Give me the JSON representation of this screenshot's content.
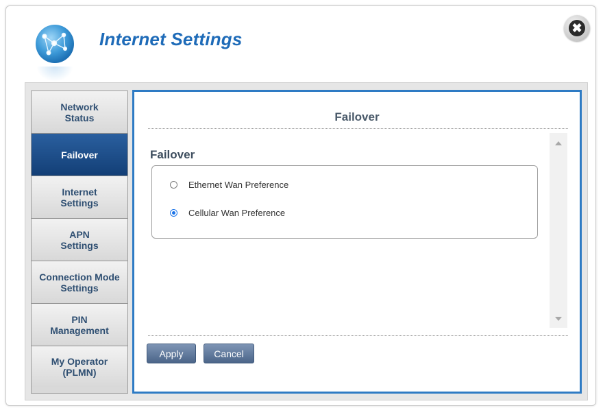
{
  "window": {
    "title": "Internet Settings",
    "close_symbol": "✖",
    "logo_icon": "globe-network-icon"
  },
  "sidebar": {
    "items": [
      {
        "label": "Network\nStatus",
        "active": false
      },
      {
        "label": "Failover",
        "active": true
      },
      {
        "label": "Internet\nSettings",
        "active": false
      },
      {
        "label": "APN\nSettings",
        "active": false
      },
      {
        "label": "Connection Mode\nSettings",
        "active": false
      },
      {
        "label": "PIN\nManagement",
        "active": false
      },
      {
        "label": "My Operator\n(PLMN)",
        "active": false
      }
    ]
  },
  "panel": {
    "title": "Failover",
    "section_heading": "Failover",
    "options": [
      {
        "label": "Ethernet Wan Preference",
        "checked": false
      },
      {
        "label": "Cellular Wan Preference",
        "checked": true
      }
    ],
    "apply_label": "Apply",
    "cancel_label": "Cancel"
  },
  "colors": {
    "accent": "#2e7bc4",
    "title": "#1e6bb8",
    "sidebar_active": "#1b4a86",
    "button": "#5c769a"
  }
}
